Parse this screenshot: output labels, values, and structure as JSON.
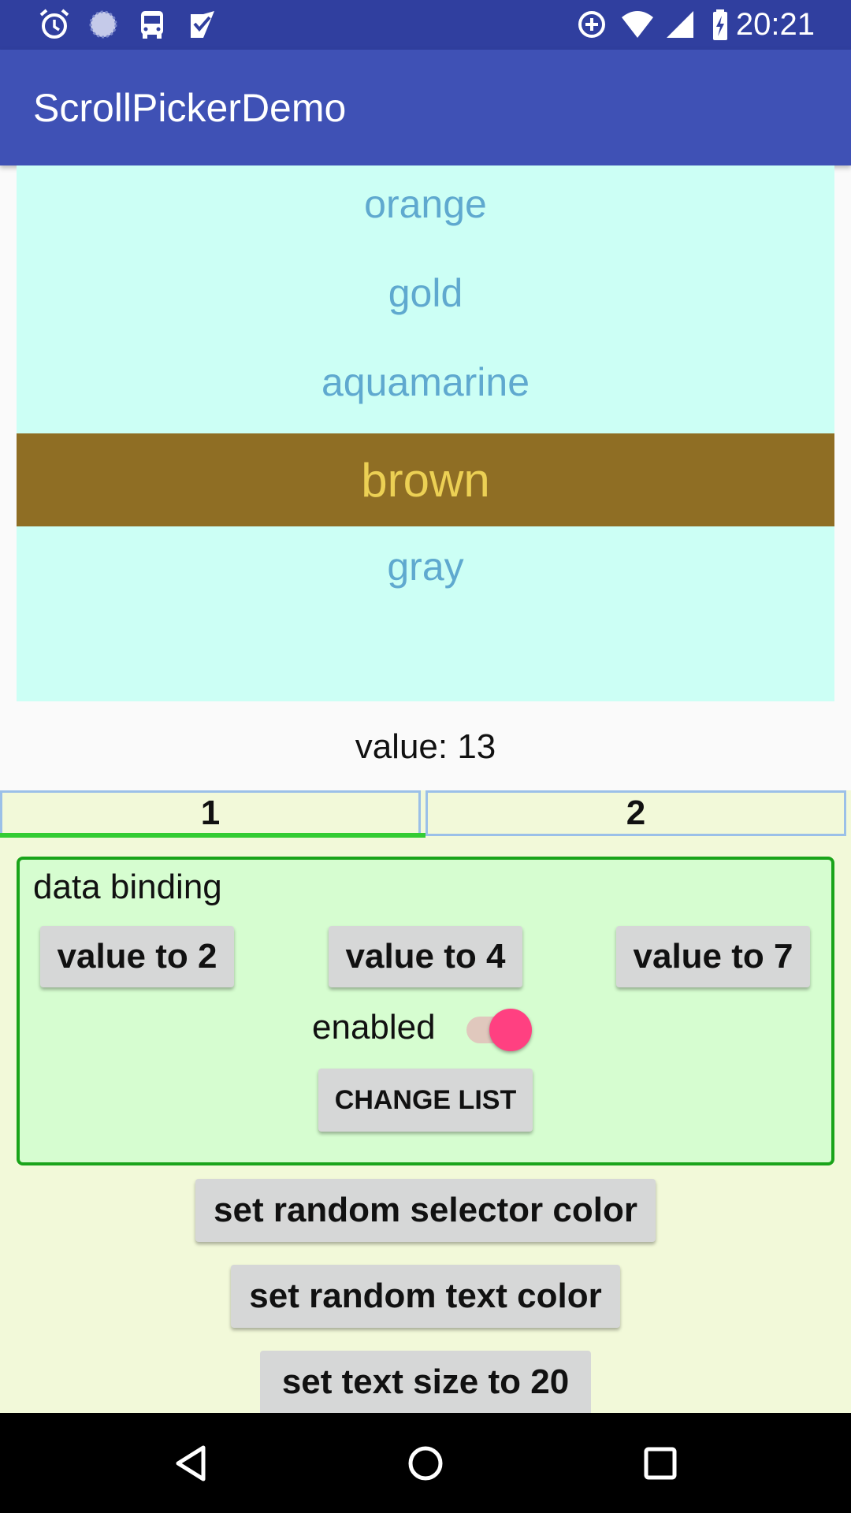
{
  "status_bar": {
    "time": "20:21",
    "left_icons": [
      "alarm-icon",
      "sync-icon",
      "bus-icon",
      "task-check-icon"
    ],
    "right_icons": [
      "data-saver-icon",
      "wifi-icon",
      "signal-icon",
      "battery-charging-icon"
    ]
  },
  "app_bar": {
    "title": "ScrollPickerDemo",
    "color": "#3f51b5",
    "status_color": "#303f9f"
  },
  "picker": {
    "background": "#ccfff5",
    "items": [
      "orange",
      "gold",
      "aquamarine",
      "brown",
      "gray"
    ],
    "selected": "brown",
    "selector_color": "#8f6e24",
    "text_color": "#5fa9cf",
    "selected_text_color": "#ecd054"
  },
  "value_label": "value: 13",
  "tabs": {
    "items": [
      "1",
      "2"
    ],
    "selected_index": 0,
    "indicator_color": "#33cc33"
  },
  "binding": {
    "title": "data binding",
    "buttons": [
      "value to 2",
      "value to 4",
      "value to 7"
    ],
    "switch_label": "enabled",
    "switch_on": true,
    "change_list": "CHANGE LIST"
  },
  "actions": {
    "random_selector_color": "set random selector color",
    "random_text_color": "set random text color",
    "text_size": "set text size to 20"
  },
  "nav_bar": {
    "icons": [
      "back-icon",
      "home-icon",
      "recents-icon"
    ]
  }
}
